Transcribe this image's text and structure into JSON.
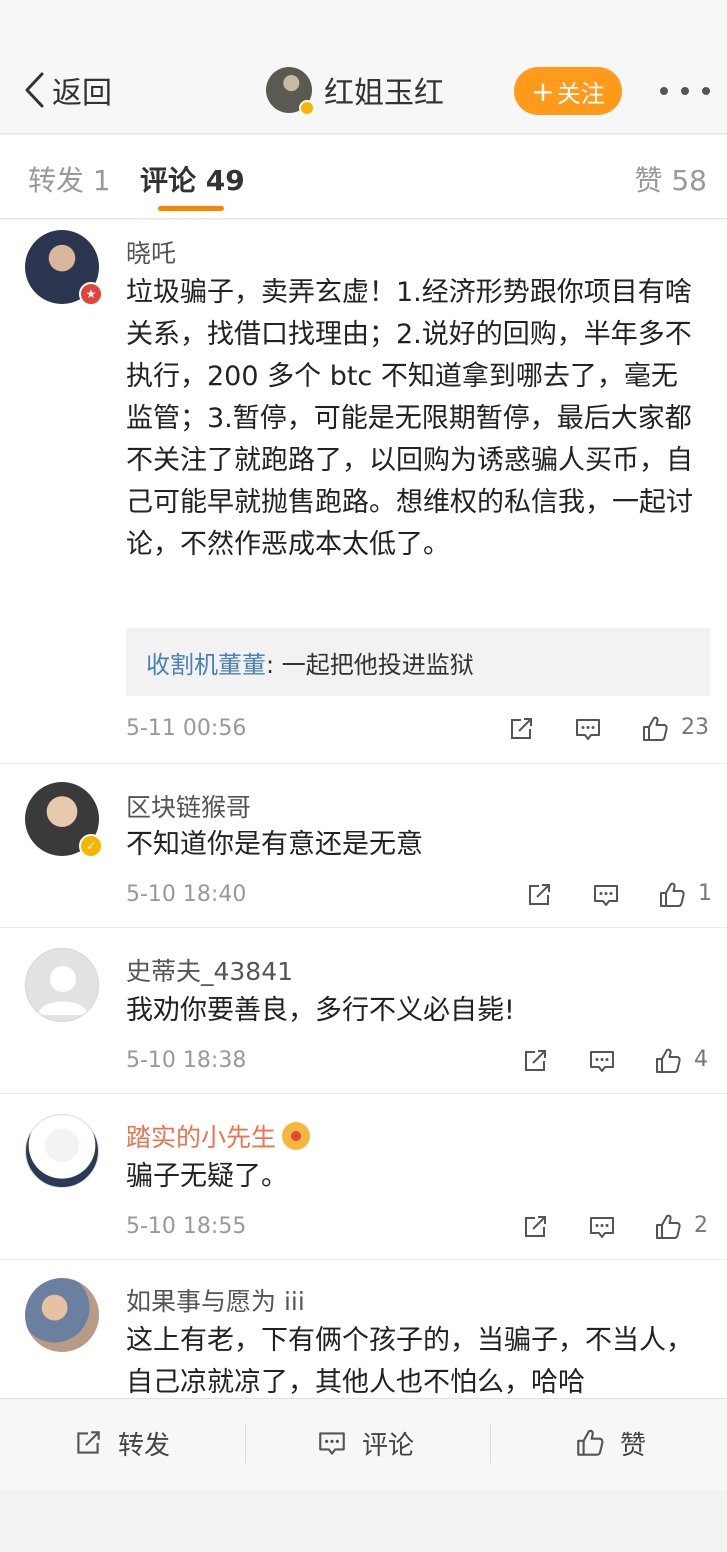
{
  "header": {
    "back_label": "返回",
    "title": "红姐玉红",
    "follow_label": "关注",
    "follow_plus": "+"
  },
  "tabs": {
    "repost": "转发 1",
    "comments": "评论 49",
    "likes": "赞 58"
  },
  "comments": [
    {
      "user": "晓吒",
      "text": "垃圾骗子，卖弄玄虚！1.经济形势跟你项目有啥关系，找借口找理由；2.说好的回购，半年多不执行，200 多个 btc 不知道拿到哪去了，毫无监管；3.暂停，可能是无限期暂停，最后大家都不关注了就跑路了，以回购为诱惑骗人买币，自己可能早就抛售跑路。想维权的私信我，一起讨论，不然作恶成本太低了。",
      "reply_user": "收割机董董",
      "reply_text": ": 一起把他投进监狱",
      "time": "5-11 00:56",
      "likes": "23"
    },
    {
      "user": "区块链猴哥",
      "text": "不知道你是有意还是无意",
      "time": "5-10 18:40",
      "likes": "1"
    },
    {
      "user": "史蒂夫_43841",
      "text": "我劝你要善良，多行不义必自毙!",
      "time": "5-10 18:38",
      "likes": "4"
    },
    {
      "user": "踏实的小先生",
      "text": "骗子无疑了。",
      "time": "5-10 18:55",
      "likes": "2"
    },
    {
      "user": "如果事与愿为 iii",
      "text": "这上有老，下有俩个孩子的，当骗子，不当人，自己凉就凉了，其他人也不怕么，哈哈"
    }
  ],
  "bottom_bar": {
    "repost": "转发",
    "comment": "评论",
    "like": "赞"
  },
  "colors": {
    "accent": "#ff8200",
    "follow_button": "#ff9a1a",
    "reply_link": "#4a7fb8",
    "member_name": "#eb7350"
  }
}
